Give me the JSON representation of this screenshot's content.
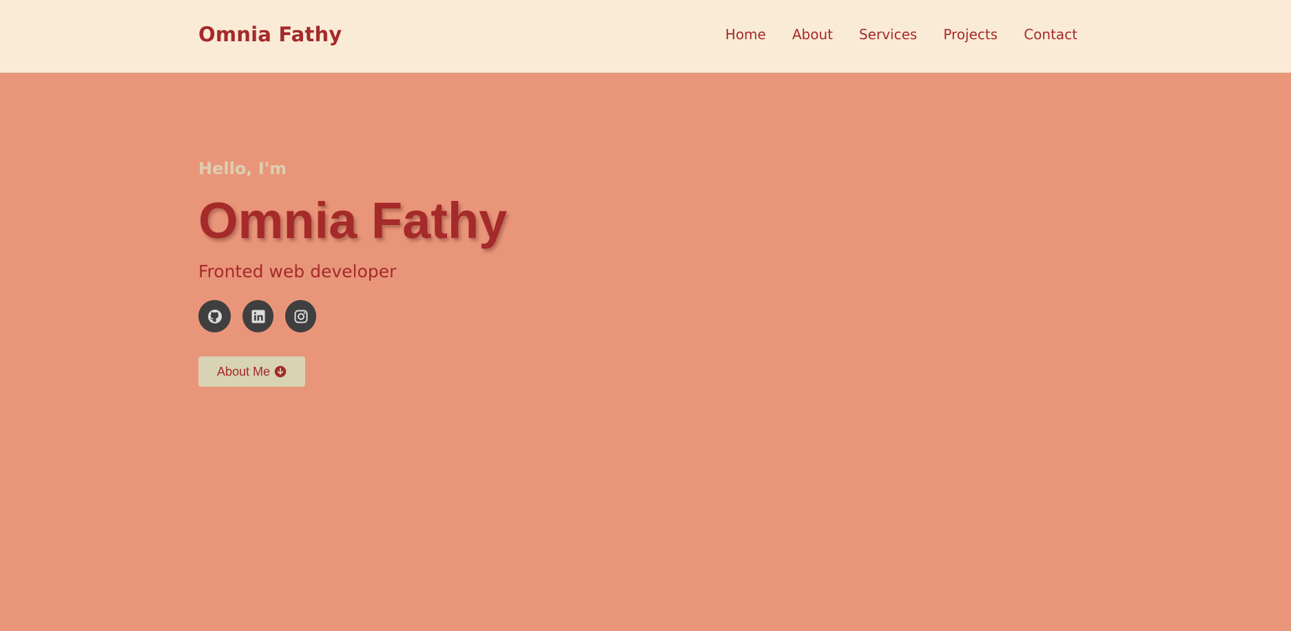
{
  "navbar": {
    "brand": "Omnia Fathy",
    "links": [
      {
        "label": "Home"
      },
      {
        "label": "About"
      },
      {
        "label": "Services"
      },
      {
        "label": "Projects"
      },
      {
        "label": "Contact"
      }
    ]
  },
  "hero": {
    "greeting": "Hello, I'm",
    "name": "Omnia Fathy",
    "role": "Fronted web developer",
    "socials": [
      {
        "icon": "github-icon"
      },
      {
        "icon": "linkedin-icon"
      },
      {
        "icon": "instagram-icon"
      }
    ],
    "cta": {
      "label": "About Me",
      "icon": "arrow-down-circle-icon"
    }
  },
  "colors": {
    "background": "#e9957a",
    "navbar": "#faebd7",
    "accent": "#a52a2a",
    "greeting": "#dccfb0",
    "social_bg": "#3f3f3f",
    "button_bg": "#d8d3b4"
  }
}
